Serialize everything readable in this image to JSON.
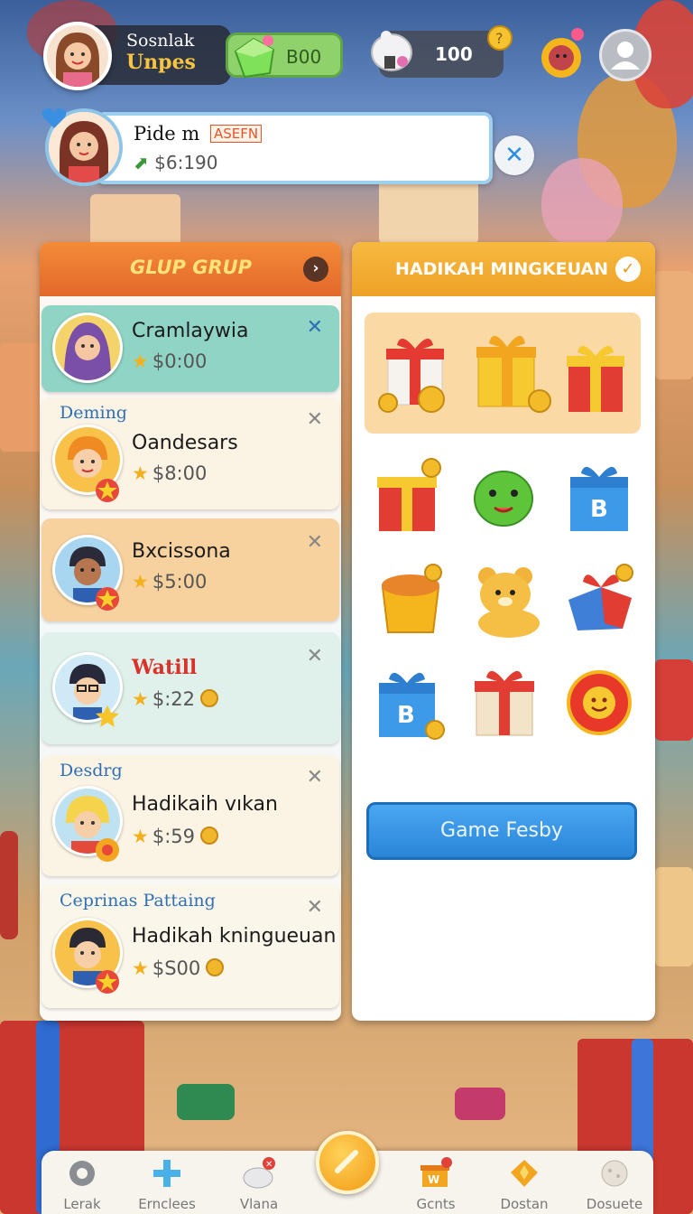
{
  "header": {
    "user_line1": "Sosnlak",
    "user_line2": "Unpes",
    "gems": "B00",
    "coins": "100"
  },
  "notification": {
    "name": "Pide m",
    "tag": "ASEFN",
    "amount": "$6:190"
  },
  "left_panel": {
    "title": "GLUP GRUP",
    "rows": [
      {
        "section": "",
        "name": "Cramlaywia",
        "amount": "$0:00"
      },
      {
        "section": "Deming",
        "name": "Oandesars",
        "amount": "$8:00"
      },
      {
        "section": "",
        "name": "Bxcissona",
        "amount": "$5:00"
      },
      {
        "section": "",
        "name": "Watill",
        "amount": "$:22"
      },
      {
        "section": "Desdrg",
        "name": "Hadikaih vıkan",
        "amount": "$:59"
      },
      {
        "section": "Ceprinas Pattaing",
        "name": "Hadikah kningueuan",
        "amount": "$S00"
      }
    ]
  },
  "right_panel": {
    "title": "HADIKAH MINGKEUAN",
    "button": "Game Fesby"
  },
  "bottom_nav": [
    {
      "label": "Lerak",
      "icon": "gear-icon"
    },
    {
      "label": "Ernclees",
      "icon": "plus-icon"
    },
    {
      "label": "Vlana",
      "icon": "cloud-icon"
    },
    {
      "label": "Gcnts",
      "icon": "gift-icon"
    },
    {
      "label": "Dostan",
      "icon": "star-icon"
    },
    {
      "label": "Dosuete",
      "icon": "cookie-icon"
    }
  ],
  "colors": {
    "left_header": "#e2682a",
    "right_header": "#eea126",
    "button": "#2a85d8"
  }
}
